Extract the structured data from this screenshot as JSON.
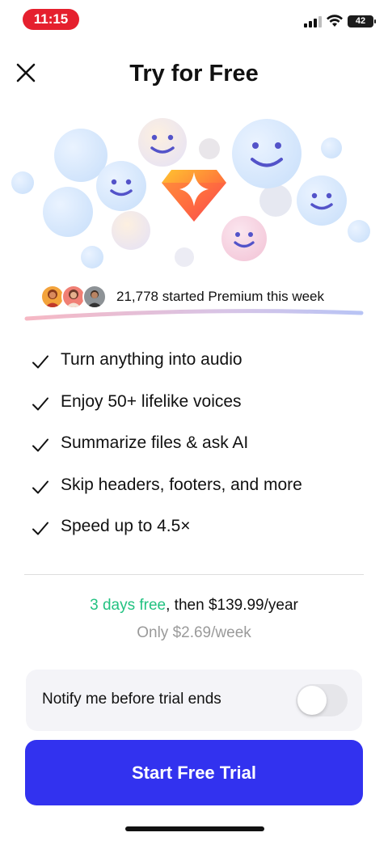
{
  "status_bar": {
    "time": "11:15",
    "battery": "42"
  },
  "header": {
    "title": "Try for Free",
    "close_icon": "close-icon"
  },
  "social_proof": {
    "text": "21,778 started Premium this week"
  },
  "features": [
    {
      "label": "Turn anything into audio"
    },
    {
      "label": "Enjoy 50+ lifelike voices"
    },
    {
      "label": "Summarize files & ask AI"
    },
    {
      "label": "Skip headers, footers, and more"
    },
    {
      "label": "Speed up to 4.5×"
    }
  ],
  "pricing": {
    "free_days": "3 days free",
    "then_text": ", then $139.99/year",
    "weekly": "Only $2.69/week"
  },
  "notify": {
    "label": "Notify me before trial ends",
    "enabled": false
  },
  "cta": {
    "label": "Start Free Trial"
  },
  "colors": {
    "primary": "#3232ef",
    "green": "#22c281",
    "status_red": "#e5202e"
  }
}
